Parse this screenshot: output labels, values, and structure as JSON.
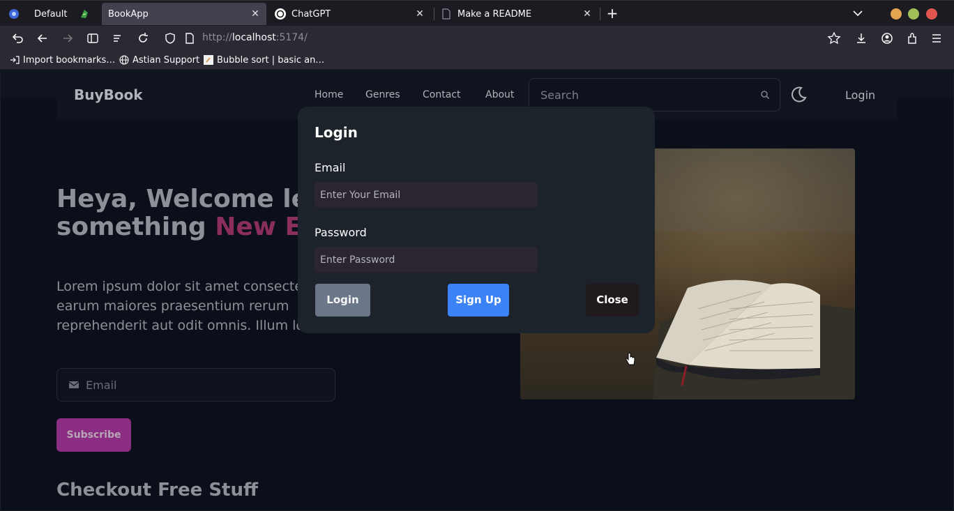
{
  "browser": {
    "tabs": [
      {
        "label": "Default",
        "active": false
      },
      {
        "label": "BookApp",
        "active": true
      },
      {
        "label": "ChatGPT",
        "active": false
      },
      {
        "label": "Make a README",
        "active": false
      }
    ],
    "url_scheme": "http://",
    "url_host": "localhost",
    "url_rest": ":5174/",
    "bookmarks": [
      "Import bookmarks…",
      "Astian Support",
      "Bubble sort | basic an…"
    ],
    "window_button_colors": [
      "#e5a550",
      "#a2c058",
      "#e0554f"
    ]
  },
  "site": {
    "brand": "BuyBook",
    "nav": [
      "Home",
      "Genres",
      "Contact",
      "About"
    ],
    "search_placeholder": "Search",
    "login_label": "Login",
    "hero": {
      "title_line1": "Heya, Welcome let",
      "title_line2_prefix": "something ",
      "title_line2_accent": "New Ev",
      "paragraph_line1": "Lorem ipsum dolor sit amet consecte",
      "paragraph_line2": "earum maiores praesentium rerum",
      "paragraph_line3": "reprehenderit aut odit omnis. Illum lo",
      "email_placeholder": "Email",
      "subscribe_label": "Subscribe"
    },
    "checkout_title": "Checkout Free Stuff"
  },
  "modal": {
    "title": "Login",
    "email_label": "Email",
    "email_placeholder": "Enter Your Email",
    "password_label": "Password",
    "password_placeholder": "Enter Password",
    "login_button": "Login",
    "signup_button": "Sign Up",
    "close_button": "Close"
  },
  "colors": {
    "accent": "#8b2d5d",
    "signup": "#3b82f6",
    "subscribe": "#8a2d83"
  }
}
